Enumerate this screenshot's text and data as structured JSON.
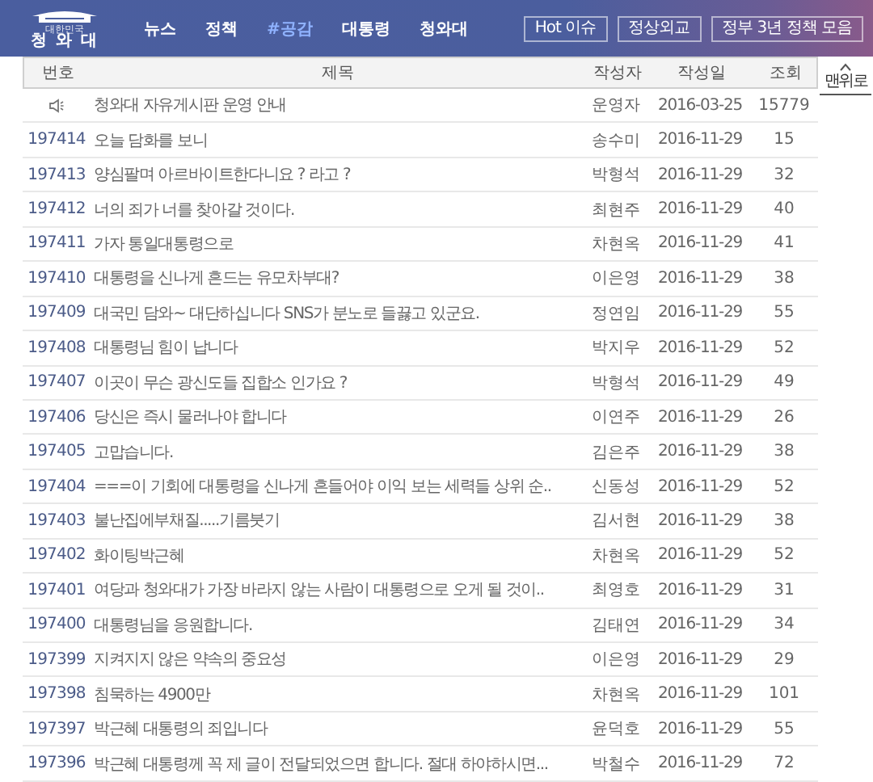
{
  "header": {
    "logo": {
      "subtitle": "대한민국",
      "title": "청 와 대"
    },
    "nav": [
      {
        "label": "뉴스",
        "selected": false
      },
      {
        "label": "정책",
        "selected": false
      },
      {
        "label": "#공감",
        "selected": true
      },
      {
        "label": "대통령",
        "selected": false
      },
      {
        "label": "청와대",
        "selected": false
      }
    ],
    "buttons": [
      "Hot 이슈",
      "정상외교",
      "정부 3년 정책 모음"
    ]
  },
  "table": {
    "columns": [
      "번호",
      "제목",
      "작성자",
      "작성일",
      "조회"
    ],
    "rows": [
      {
        "kind": "notice",
        "title": "청와대 자유게시판 운영 안내",
        "author": "운영자",
        "date": "2016-03-25",
        "views": "15779"
      },
      {
        "kind": "post",
        "number": "197414",
        "title": "오늘 담화를 보니",
        "author": "송수미",
        "date": "2016-11-29",
        "views": "15"
      },
      {
        "kind": "post",
        "number": "197413",
        "title": "양심팔며 아르바이트한다니요 ? 라고 ?",
        "author": "박형석",
        "date": "2016-11-29",
        "views": "32"
      },
      {
        "kind": "post",
        "number": "197412",
        "title": "너의 죄가 너를 찾아갈 것이다.",
        "author": "최현주",
        "date": "2016-11-29",
        "views": "40"
      },
      {
        "kind": "post",
        "number": "197411",
        "title": "가자 통일대통령으로",
        "author": "차현옥",
        "date": "2016-11-29",
        "views": "41"
      },
      {
        "kind": "post",
        "number": "197410",
        "title": "대통령을 신나게 흔드는 유모차부대?",
        "author": "이은영",
        "date": "2016-11-29",
        "views": "38"
      },
      {
        "kind": "post",
        "number": "197409",
        "title": "대국민 담와~ 대단하십니다 SNS가 분노로 들끓고 있군요.",
        "author": "정연임",
        "date": "2016-11-29",
        "views": "55"
      },
      {
        "kind": "post",
        "number": "197408",
        "title": "대통령님 힘이 납니다",
        "author": "박지우",
        "date": "2016-11-29",
        "views": "52"
      },
      {
        "kind": "post",
        "number": "197407",
        "title": "이곳이 무슨 광신도들 집합소 인가요 ?",
        "author": "박형석",
        "date": "2016-11-29",
        "views": "49"
      },
      {
        "kind": "post",
        "number": "197406",
        "title": "당신은 즉시 물러나야 합니다",
        "author": "이연주",
        "date": "2016-11-29",
        "views": "26"
      },
      {
        "kind": "post",
        "number": "197405",
        "title": "고맙습니다.",
        "author": "김은주",
        "date": "2016-11-29",
        "views": "38"
      },
      {
        "kind": "post",
        "number": "197404",
        "title": "===이 기회에 대통령을 신나게 흔들어야 이익 보는 세력들 상위 순..",
        "author": "신동성",
        "date": "2016-11-29",
        "views": "52"
      },
      {
        "kind": "post",
        "number": "197403",
        "title": "불난집에부채질.....기름붓기",
        "author": "김서현",
        "date": "2016-11-29",
        "views": "38"
      },
      {
        "kind": "post",
        "number": "197402",
        "title": "화이팅박근혜",
        "author": "차현옥",
        "date": "2016-11-29",
        "views": "52"
      },
      {
        "kind": "post",
        "number": "197401",
        "title": "여당과 청와대가 가장 바라지 않는 사람이 대통령으로 오게 될 것이..",
        "author": "최영호",
        "date": "2016-11-29",
        "views": "31"
      },
      {
        "kind": "post",
        "number": "197400",
        "title": "대통령님을 응원합니다.",
        "author": "김태연",
        "date": "2016-11-29",
        "views": "34"
      },
      {
        "kind": "post",
        "number": "197399",
        "title": "지켜지지 않은 약속의 중요성",
        "author": "이은영",
        "date": "2016-11-29",
        "views": "29"
      },
      {
        "kind": "post",
        "number": "197398",
        "title": "침묵하는 4900만",
        "author": "차현옥",
        "date": "2016-11-29",
        "views": "101"
      },
      {
        "kind": "post",
        "number": "197397",
        "title": "박근혜 대통령의 죄입니다",
        "author": "윤덕호",
        "date": "2016-11-29",
        "views": "55"
      },
      {
        "kind": "post",
        "number": "197396",
        "title": "박근혜 대통령께 꼭 제 글이 전달되었으면 합니다. 절대 하야하시면...",
        "author": "박철수",
        "date": "2016-11-29",
        "views": "72"
      }
    ]
  },
  "top_button": {
    "label": "맨위로"
  }
}
